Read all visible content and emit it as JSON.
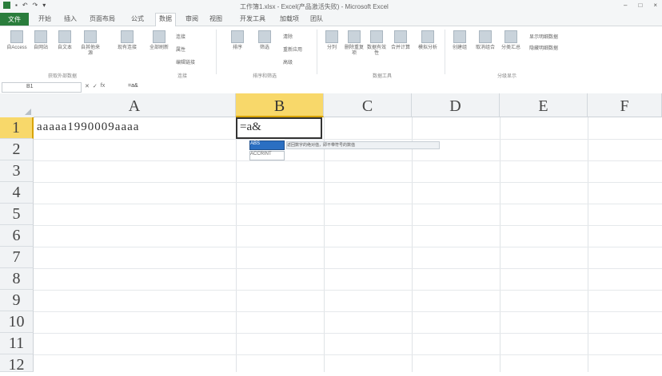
{
  "titlebar": {
    "title": "工作簿1.xlsx - Excel(产品激活失败) - Microsoft Excel",
    "minimize": "–",
    "maximize": "□",
    "close": "×"
  },
  "tabs": [
    "文件",
    "开始",
    "插入",
    "页面布局",
    "公式",
    "数据",
    "审阅",
    "视图",
    "开发工具",
    "加载项",
    "团队"
  ],
  "active_tab_index": 5,
  "ribbon": {
    "buttons": [
      "自Access",
      "自网站",
      "自文本",
      "自其他来源",
      "现有连接",
      "全部刷新",
      "连接",
      "属性",
      "编辑链接",
      "排序",
      "筛选",
      "清除",
      "重新应用",
      "高级",
      "分列",
      "删除重复项",
      "数据有效性",
      "合并计算",
      "模拟分析",
      "创建组",
      "取消组合",
      "分类汇总",
      "显示明细数据",
      "隐藏明细数据"
    ],
    "groups": [
      "获取外部数据",
      "连接",
      "排序和筛选",
      "数据工具",
      "分级显示"
    ]
  },
  "formula_bar": {
    "name_box": "B1",
    "formula": "=a&"
  },
  "columns": [
    "A",
    "B",
    "C",
    "D",
    "E",
    "F"
  ],
  "selected_column": "B",
  "rows": [
    "1",
    "2",
    "3",
    "4",
    "5",
    "6",
    "7",
    "8",
    "9",
    "10",
    "11",
    "12"
  ],
  "selected_row": "1",
  "cells": {
    "A1": "aaaaa1990009aaaa",
    "B1": "=a&"
  },
  "autocomplete": {
    "items": [
      "ABS",
      "ACCRINT"
    ],
    "tip": "返回数字的绝对值，即不带符号的数值"
  }
}
